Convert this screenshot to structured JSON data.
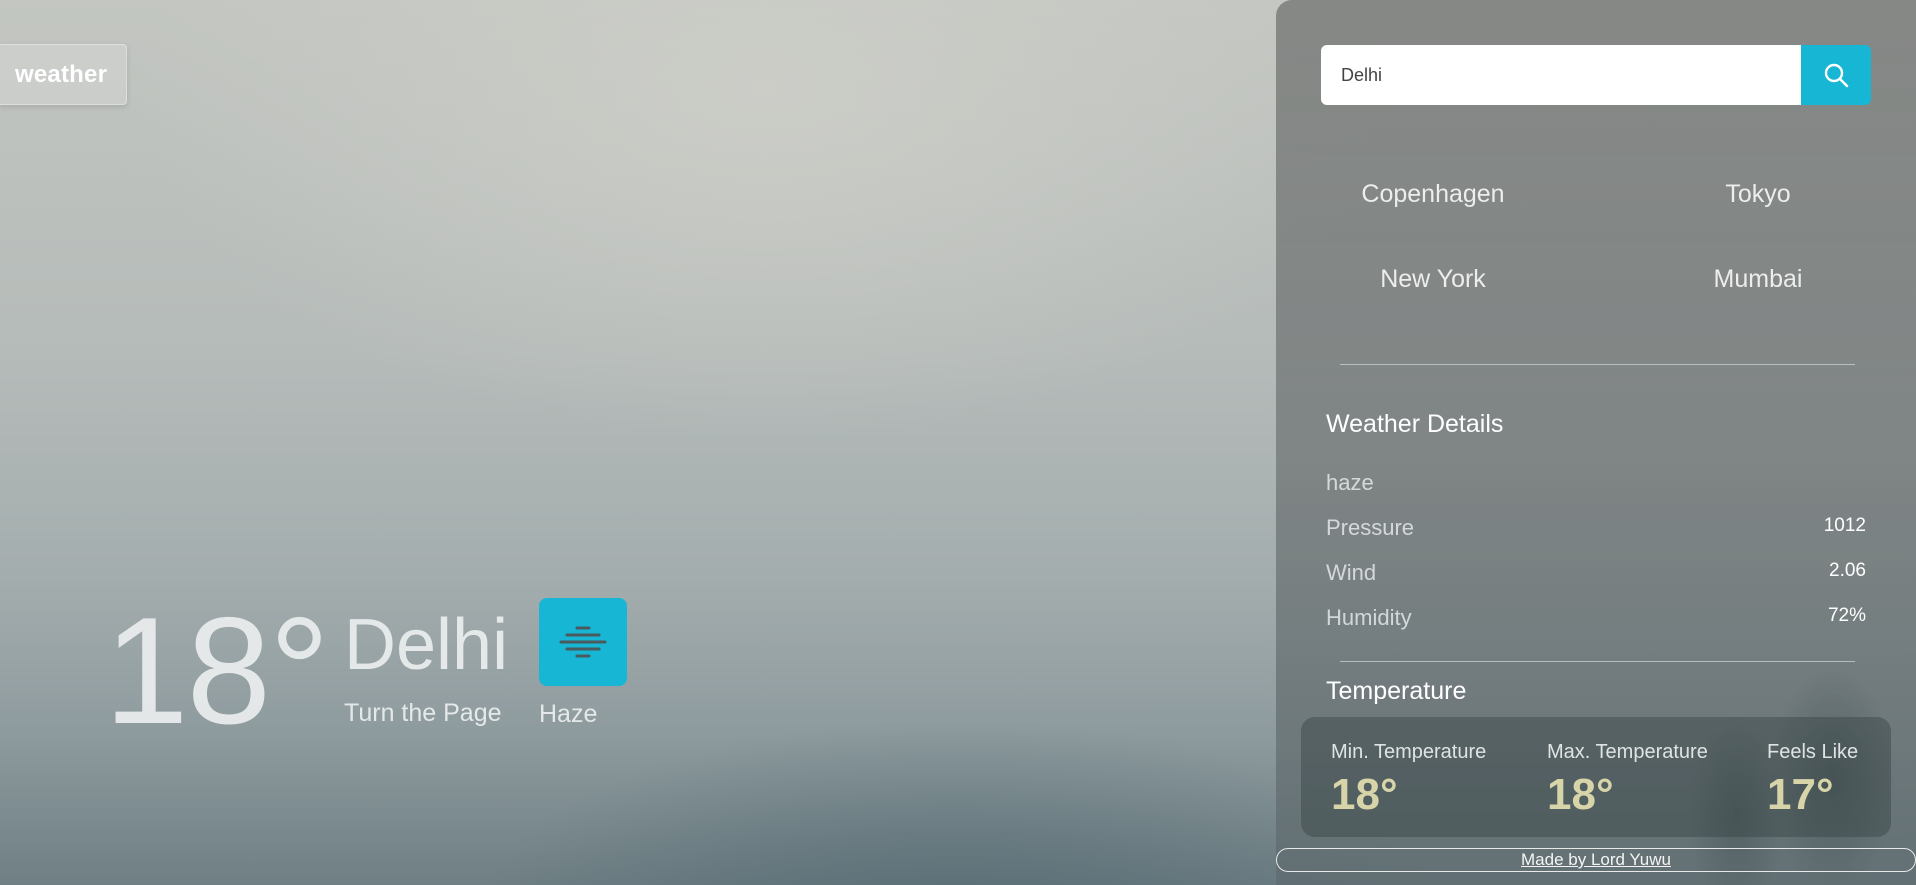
{
  "brand": {
    "label": "weather"
  },
  "current": {
    "temperature": "18°",
    "city": "Delhi",
    "tagline": "Turn the Page",
    "condition": "Haze",
    "condition_icon": "haze-icon"
  },
  "search": {
    "value": "Delhi",
    "button_icon": "search-icon"
  },
  "cities": [
    "Copenhagen",
    "Tokyo",
    "New York",
    "Mumbai"
  ],
  "details": {
    "title": "Weather Details",
    "description": "haze",
    "rows": [
      {
        "label": "Pressure",
        "value": "1012"
      },
      {
        "label": "Wind",
        "value": "2.06"
      },
      {
        "label": "Humidity",
        "value": "72%"
      }
    ]
  },
  "temperature_section": {
    "title": "Temperature",
    "items": [
      {
        "label": "Min. Temperature",
        "value": "18°"
      },
      {
        "label": "Max. Temperature",
        "value": "18°"
      },
      {
        "label": "Feels Like",
        "value": "17°"
      }
    ]
  },
  "footer": {
    "link_text": "Made by Lord Yuwu"
  },
  "colors": {
    "accent": "#16b6d4",
    "temp_value": "#d6d4a8"
  }
}
